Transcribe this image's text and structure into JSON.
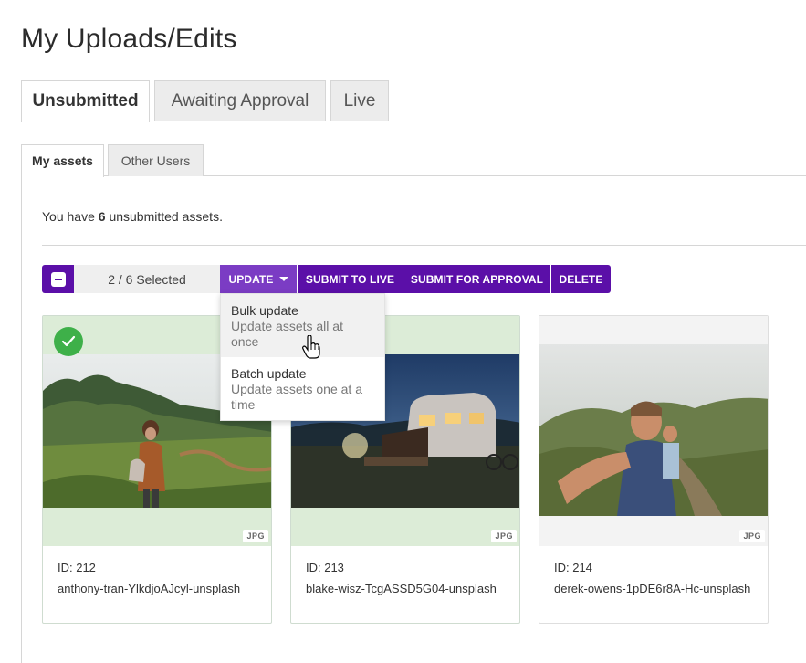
{
  "page": {
    "title": "My Uploads/Edits"
  },
  "main_tabs": [
    {
      "label": "Unsubmitted",
      "active": true
    },
    {
      "label": "Awaiting Approval",
      "active": false
    },
    {
      "label": "Live",
      "active": false
    }
  ],
  "sub_tabs": [
    {
      "label": "My assets",
      "active": true
    },
    {
      "label": "Other Users",
      "active": false
    }
  ],
  "summary": {
    "prefix": "You have",
    "count": "6",
    "suffix": "unsubmitted assets."
  },
  "toolbar": {
    "selected_text": "2  / 6 Selected",
    "update_label": "UPDATE",
    "submit_live_label": "SUBMIT TO LIVE",
    "submit_approval_label": "SUBMIT FOR APPROVAL",
    "delete_label": "DELETE"
  },
  "update_menu": [
    {
      "title": "Bulk update",
      "description": "Update assets all at once"
    },
    {
      "title": "Batch update",
      "description": "Update assets one at a time"
    }
  ],
  "assets": [
    {
      "id_label": "ID: 212",
      "filename": "anthony-tran-YlkdjoAJcyl-unsplash",
      "format": "JPG",
      "selected": true
    },
    {
      "id_label": "ID: 213",
      "filename": "blake-wisz-TcgASSD5G04-unsplash",
      "format": "JPG",
      "selected": true
    },
    {
      "id_label": "ID: 214",
      "filename": "derek-owens-1pDE6r8A-Hc-unsplash",
      "format": "JPG",
      "selected": false
    }
  ],
  "colors": {
    "primary": "#5b0fa8",
    "primary_active": "#7b3cc4",
    "selected_bg": "#dcecd7",
    "check": "#3eb049"
  }
}
